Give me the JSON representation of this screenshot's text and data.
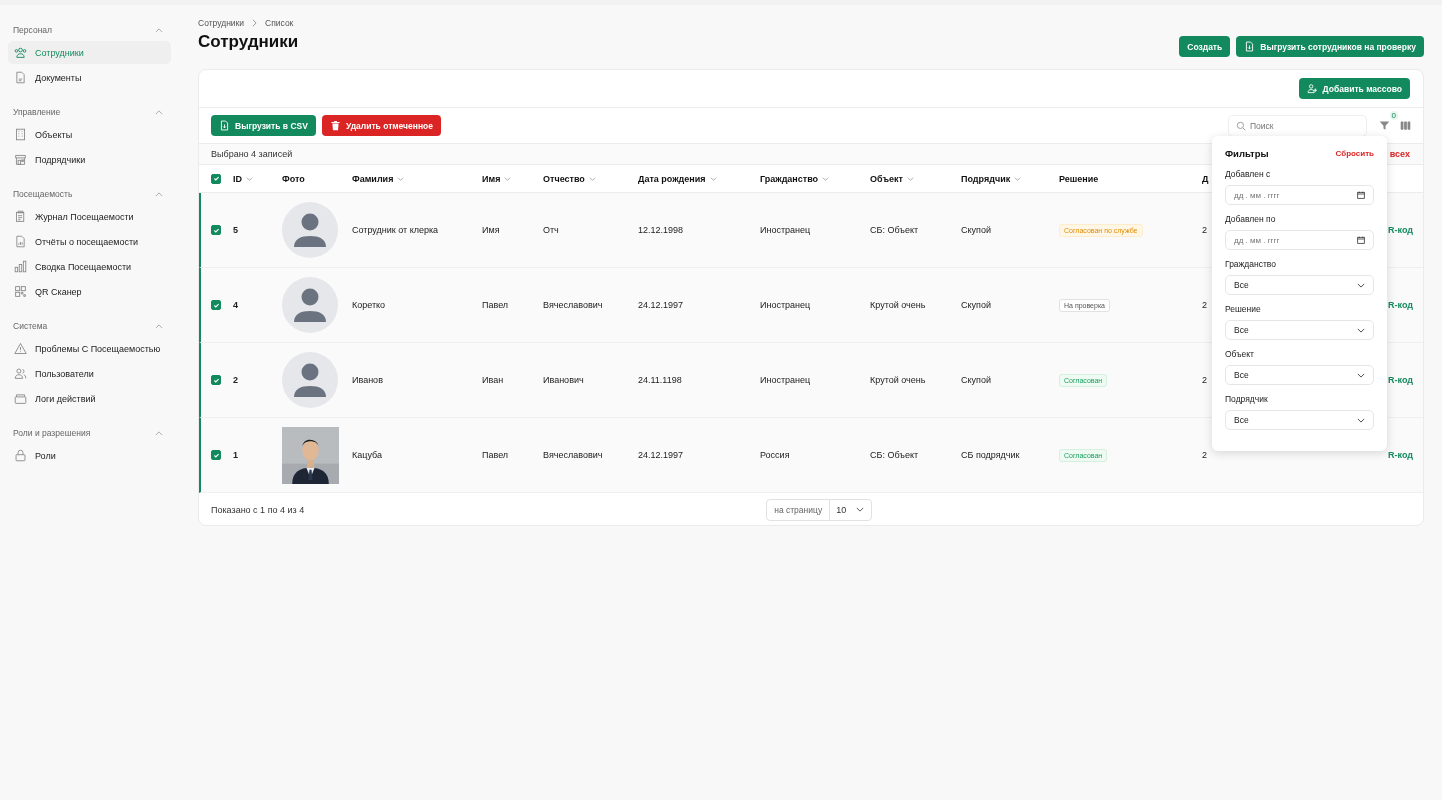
{
  "sidebar": {
    "sections": [
      {
        "title": "Персонал",
        "expanded": true,
        "items": [
          {
            "label": "Сотрудники",
            "selected": true
          },
          {
            "label": "Документы",
            "selected": false
          }
        ]
      },
      {
        "title": "Управление",
        "expanded": true,
        "items": [
          {
            "label": "Объекты",
            "selected": false
          },
          {
            "label": "Подрядчики",
            "selected": false
          }
        ]
      },
      {
        "title": "Посещаемость",
        "expanded": true,
        "items": [
          {
            "label": "Журнал Посещаемости",
            "selected": false
          },
          {
            "label": "Отчёты о посещаемости",
            "selected": false
          },
          {
            "label": "Сводка Посещаемости",
            "selected": false
          },
          {
            "label": "QR Сканер",
            "selected": false
          }
        ]
      },
      {
        "title": "Система",
        "expanded": true,
        "items": [
          {
            "label": "Проблемы С Посещаемостью",
            "selected": false
          },
          {
            "label": "Пользователи",
            "selected": false
          },
          {
            "label": "Логи действий",
            "selected": false
          }
        ]
      },
      {
        "title": "Роли и разрешения",
        "expanded": true,
        "items": [
          {
            "label": "Роли",
            "selected": false
          }
        ]
      }
    ]
  },
  "breadcrumb": [
    "Сотрудники",
    "Список"
  ],
  "title": "Сотрудники",
  "header_buttons": [
    {
      "label": "Создать",
      "icon": false
    },
    {
      "label": "Выгрузить сотрудников на проверку",
      "icon": true
    }
  ],
  "bulk_add_button": "Добавить массово",
  "export_csv_button": "Выгрузить в CSV",
  "delete_selected_button": "Удалить отмеченное",
  "search": {
    "placeholder": "Поиск"
  },
  "filter_count": "0",
  "selection": {
    "text": "Выбрано 4 записей",
    "clear_link": "всех"
  },
  "table": {
    "all_checked": true,
    "columns": [
      {
        "label": "ID",
        "sortable": true
      },
      {
        "label": "Фото",
        "sortable": false
      },
      {
        "label": "Фамилия",
        "sortable": true
      },
      {
        "label": "Имя",
        "sortable": true
      },
      {
        "label": "Отчество",
        "sortable": true
      },
      {
        "label": "Дата рождения",
        "sortable": true
      },
      {
        "label": "Гражданство",
        "sortable": true
      },
      {
        "label": "Объект",
        "sortable": true
      },
      {
        "label": "Подрядчик",
        "sortable": true
      },
      {
        "label": "Решение",
        "sortable": false
      },
      {
        "label": "Д",
        "sortable": false
      }
    ],
    "rows": [
      {
        "checked": true,
        "id": "5",
        "photo": {
          "kind": "avatar"
        },
        "last_name": "Сотрудник от клерка",
        "first_name": "Имя",
        "patronymic": "Отч",
        "birth_date": "12.12.1998",
        "citizenship": "Иностранец",
        "object": "СБ: Объект",
        "contractor": "Скупой",
        "decision": {
          "label": "Согласован по службе",
          "kind": "warning"
        },
        "column_12": "2",
        "qr_link": "R-код"
      },
      {
        "checked": true,
        "id": "4",
        "photo": {
          "kind": "avatar"
        },
        "last_name": "Коретко",
        "first_name": "Павел",
        "patronymic": "Вячеславович",
        "birth_date": "24.12.1997",
        "citizenship": "Иностранец",
        "object": "Крутой очень",
        "contractor": "Скупой",
        "decision": {
          "label": "На проверка",
          "kind": "neutral"
        },
        "column_12": "2",
        "qr_link": "R-код"
      },
      {
        "checked": true,
        "id": "2",
        "photo": {
          "kind": "avatar"
        },
        "last_name": "Иванов",
        "first_name": "Иван",
        "patronymic": "Иванович",
        "birth_date": "24.11.1198",
        "citizenship": "Иностранец",
        "object": "Крутой очень",
        "contractor": "Скупой",
        "decision": {
          "label": "Согласован",
          "kind": "success"
        },
        "column_12": "2",
        "qr_link": "R-код"
      },
      {
        "checked": true,
        "id": "1",
        "last_name": "Кацуба",
        "first_name": "Павел",
        "patronymic": "Вячеславович",
        "birth_date": "24.12.1997",
        "citizenship": "Россия",
        "object": "СБ: Объект",
        "contractor": "СБ подрядчик",
        "decision": {
          "label": "Согласован",
          "kind": "success"
        },
        "column_12": "2",
        "qr_link": "R-код"
      }
    ]
  },
  "footer": {
    "summary": "Показано с 1 по 4 из 4",
    "per_page_label": "на страницу",
    "per_page_value": "10"
  },
  "filters": {
    "title": "Фильтры",
    "reset": "Сбросить",
    "fields": [
      {
        "label": "Добавлен с",
        "kind": "date",
        "placeholder": "дд . мм . гггг"
      },
      {
        "label": "Добавлен по",
        "kind": "date",
        "placeholder": "дд . мм . гггг"
      },
      {
        "label": "Гражданство",
        "kind": "select",
        "value": "Все"
      },
      {
        "label": "Решение",
        "kind": "select",
        "value": "Все"
      },
      {
        "label": "Объект",
        "kind": "select",
        "value": "Все"
      },
      {
        "label": "Подрядчик",
        "kind": "select",
        "value": "Все"
      }
    ]
  }
}
